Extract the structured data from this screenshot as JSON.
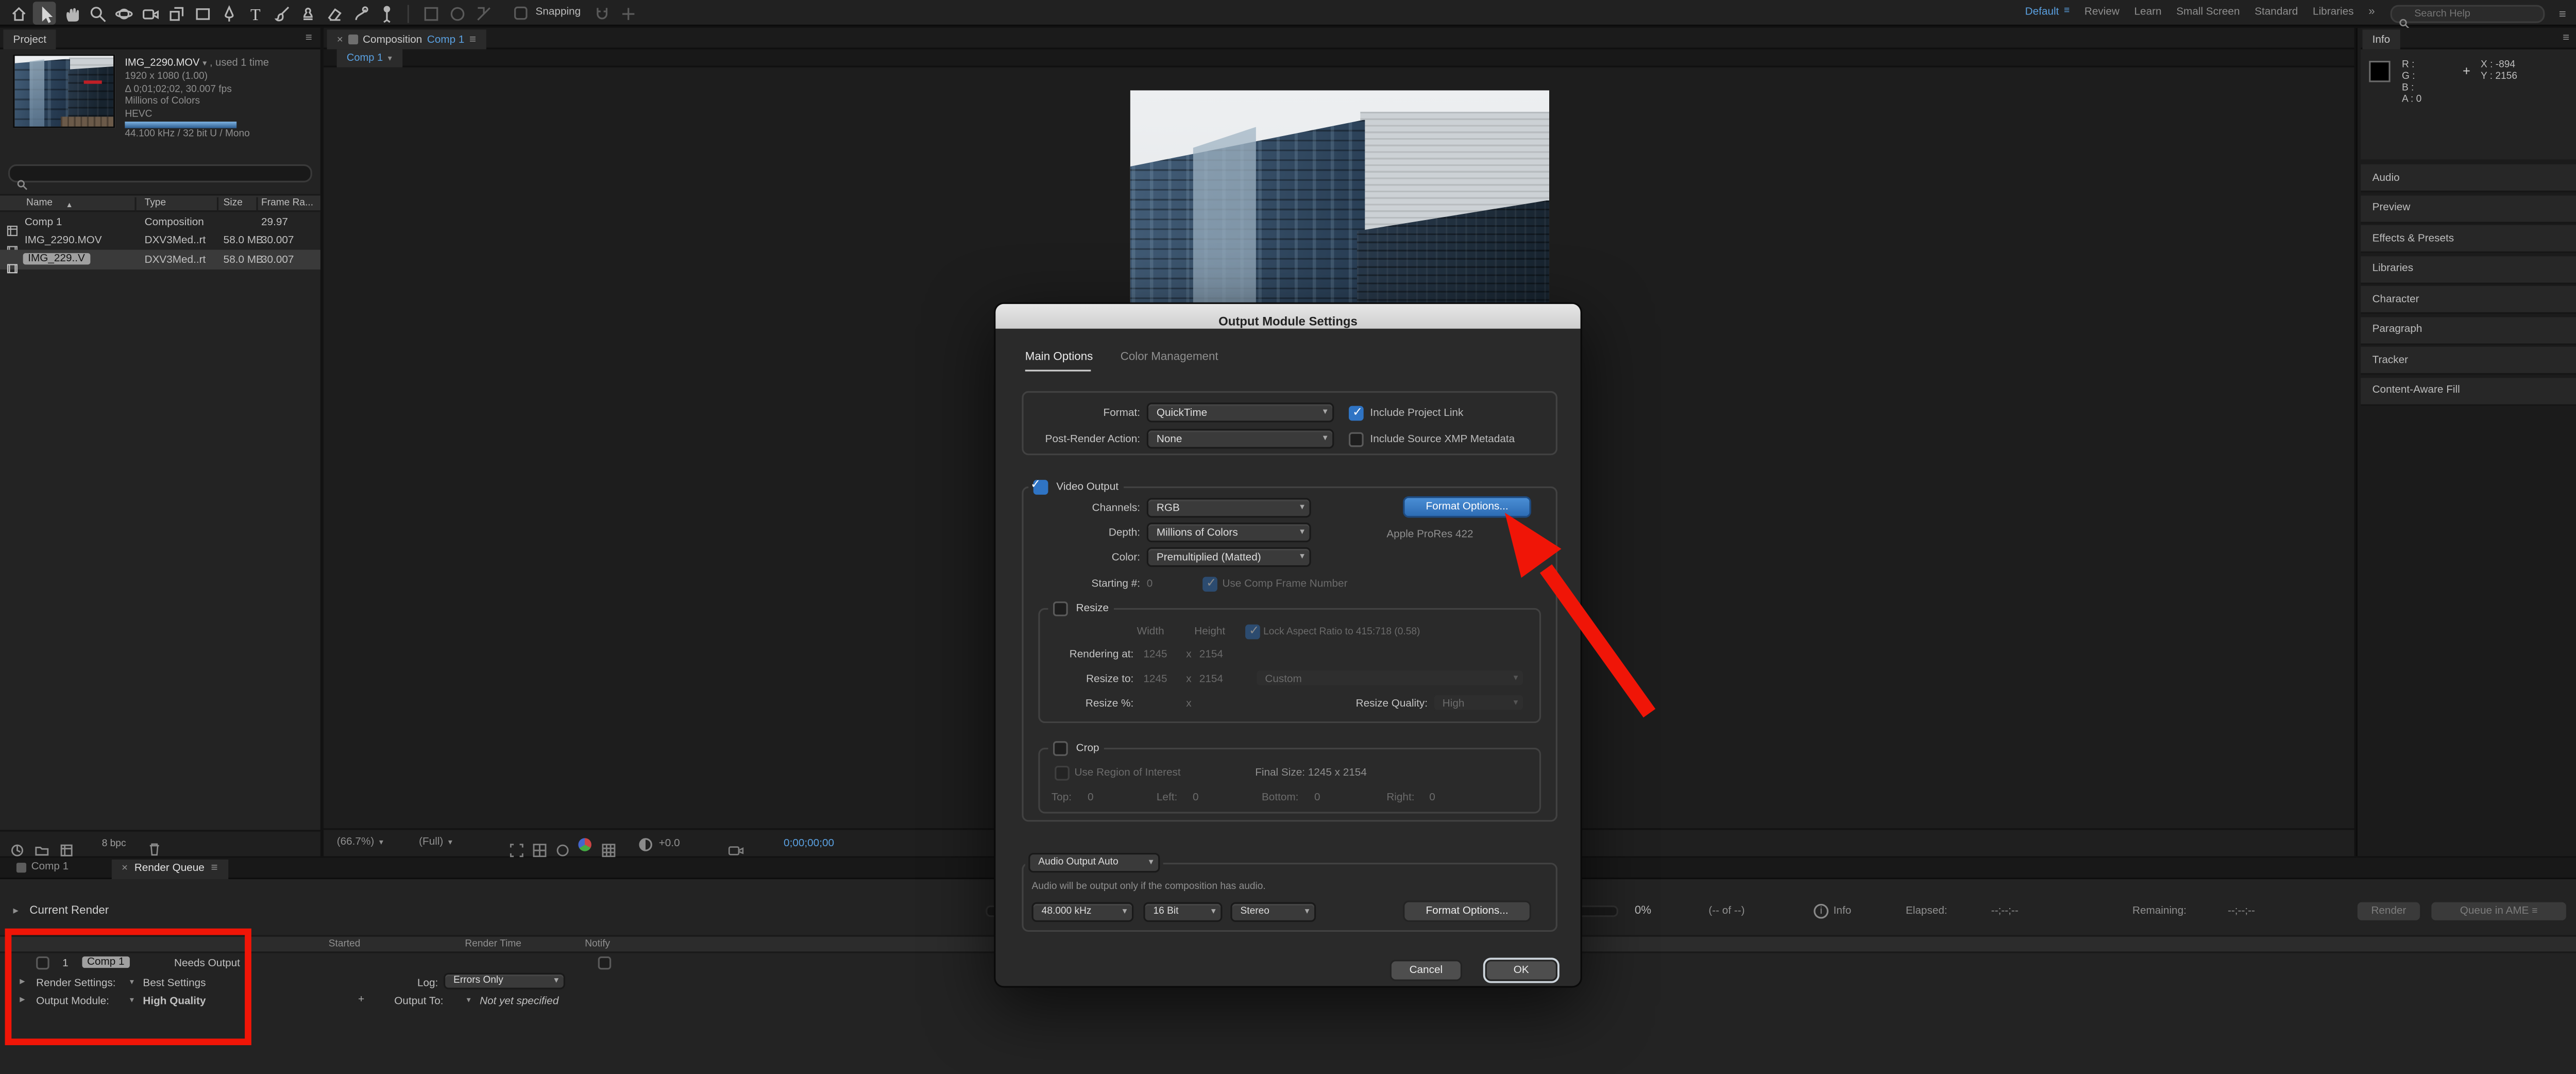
{
  "icons": {
    "menu": "≡",
    "close": "×",
    "caret_down": "▾",
    "sort_asc": "▲",
    "disclosure": "▸",
    "chevrons": "»",
    "plus": "+",
    "crosshair": "+"
  },
  "toolbar": {
    "snapping_label": "Snapping",
    "workspaces": [
      "Default",
      "Review",
      "Learn",
      "Small Screen",
      "Standard",
      "Libraries"
    ],
    "search_placeholder": "Search Help"
  },
  "project": {
    "tab": "Project",
    "preview_name": "IMG_2290.MOV",
    "preview_usage": ", used 1 time",
    "preview_info": [
      "1920 x 1080 (1.00)",
      "Δ 0;01;02;02, 30.007 fps",
      "Millions of Colors",
      "HEVC",
      "44.100 kHz / 32 bit U / Mono"
    ],
    "columns": [
      "Name",
      "Type",
      "Size",
      "Frame Ra..."
    ],
    "rows": [
      {
        "name": "Comp 1",
        "type": "Composition",
        "size": "",
        "rate": "29.97"
      },
      {
        "name": "IMG_2290.MOV",
        "type": "DXV3Med..rt",
        "size": "58.0 MB",
        "rate": "30.007"
      },
      {
        "name": "IMG_229..V",
        "type": "DXV3Med..rt",
        "size": "58.0 MB",
        "rate": "30.007"
      }
    ],
    "bpc": "8 bpc"
  },
  "comp": {
    "panel_title": "Composition",
    "active_comp": "Comp 1",
    "viewer_tab": "Comp 1",
    "zoom": "(66.7%)",
    "resolution": "(Full)",
    "exposure": "+0.0",
    "timecode": "0;00;00;00"
  },
  "dialog": {
    "title": "Output Module Settings",
    "tab_main": "Main Options",
    "tab_color": "Color Management",
    "format_label": "Format:",
    "format_value": "QuickTime",
    "include_link": "Include Project Link",
    "post_label": "Post-Render Action:",
    "post_value": "None",
    "include_xmp": "Include Source XMP Metadata",
    "video_output": "Video Output",
    "channels_label": "Channels:",
    "channels_value": "RGB",
    "format_options_btn": "Format Options...",
    "depth_label": "Depth:",
    "depth_value": "Millions of Colors",
    "codec": "Apple ProRes 422",
    "color_label": "Color:",
    "color_value": "Premultiplied (Matted)",
    "starting_label": "Starting #:",
    "starting_value": "0",
    "use_comp_frame": "Use Comp Frame Number",
    "resize_label": "Resize",
    "width_label": "Width",
    "height_label": "Height",
    "lock_aspect": "Lock Aspect Ratio to 415:718 (0.58)",
    "rendering_label": "Rendering at:",
    "size_w": "1245",
    "size_x": "x",
    "size_h": "2154",
    "resize_to_label": "Resize to:",
    "resize_preset": "Custom",
    "resize_pct_label": "Resize %:",
    "quality_label": "Resize Quality:",
    "quality_value": "High",
    "crop_label": "Crop",
    "roi_label": "Use Region of Interest",
    "final_size": "Final Size: 1245 x 2154",
    "top_label": "Top:",
    "top_value": "0",
    "left_label": "Left:",
    "left_value": "0",
    "bottom_label": "Bottom:",
    "bottom_value": "0",
    "right_label": "Right:",
    "right_value": "0",
    "audio_mode": "Audio Output Auto",
    "audio_note": "Audio will be output only if the composition has audio.",
    "audio_rate": "48.000 kHz",
    "audio_depth": "16 Bit",
    "audio_channels": "Stereo",
    "audio_format_btn": "Format Options...",
    "cancel_btn": "Cancel",
    "ok_btn": "OK"
  },
  "info": {
    "title": "Info",
    "r": "R :",
    "g": "G :",
    "b": "B :",
    "a": "A : 0",
    "x": "X : -894",
    "y": "Y : 2156"
  },
  "dock_panels": [
    "Audio",
    "Preview",
    "Effects & Presets",
    "Libraries",
    "Character",
    "Paragraph",
    "Tracker",
    "Content-Aware Fill"
  ],
  "rq": {
    "tab_comp": "Comp 1",
    "tab_queue": "Render Queue",
    "current_render": "Current Render",
    "percent": "0%",
    "frames": "(-- of --)",
    "info": "Info",
    "elapsed_label": "Elapsed:",
    "elapsed": "--;--;--",
    "remaining_label": "Remaining:",
    "remaining": "--;--;--",
    "render_btn": "Render",
    "ame_btn": "Queue in AME",
    "col_started": "Started",
    "col_render_time": "Render Time",
    "col_notify": "Notify",
    "item_num": "1",
    "item_name": "Comp 1",
    "item_status": "Needs Output",
    "rs_label": "Render Settings:",
    "rs_value": "Best Settings",
    "log_label": "Log:",
    "log_value": "Errors Only",
    "om_label": "Output Module:",
    "om_value": "High Quality",
    "out_label": "Output To:",
    "out_value": "Not yet specified"
  }
}
